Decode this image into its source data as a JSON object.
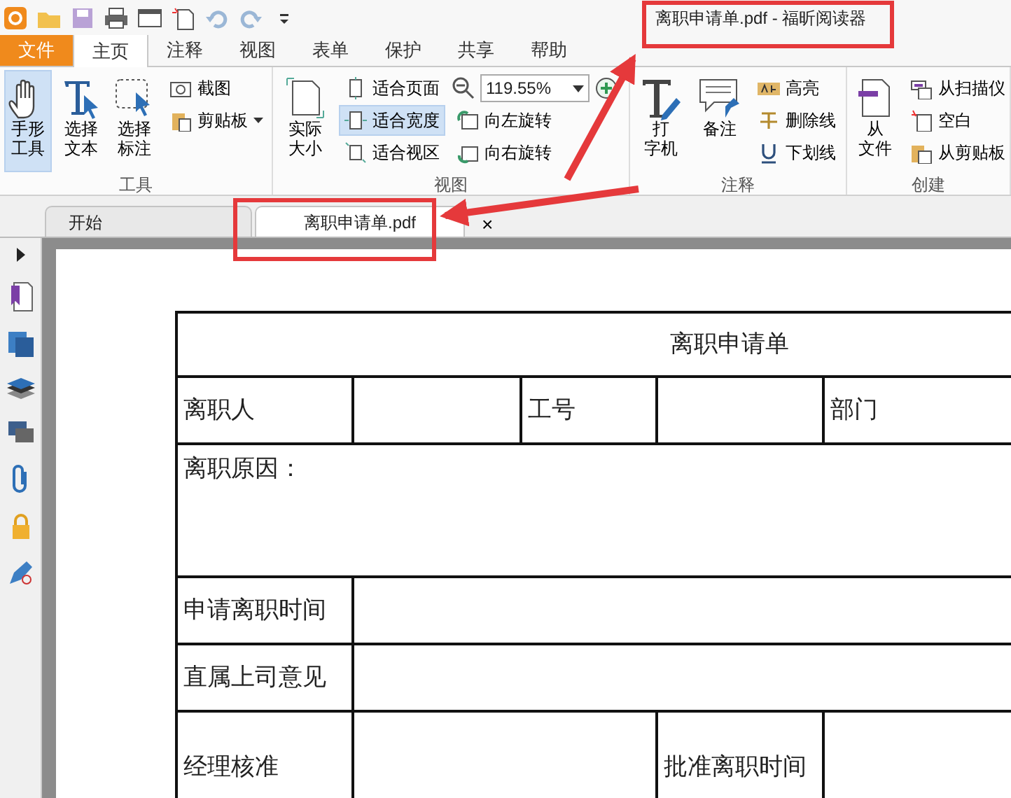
{
  "window": {
    "title": "离职申请单.pdf - 福昕阅读器"
  },
  "menu_tabs": [
    {
      "label": "文件",
      "kind": "file",
      "selected": false
    },
    {
      "label": "主页",
      "kind": "tab",
      "selected": true
    },
    {
      "label": "注释",
      "kind": "tab",
      "selected": false
    },
    {
      "label": "视图",
      "kind": "tab",
      "selected": false
    },
    {
      "label": "表单",
      "kind": "tab",
      "selected": false
    },
    {
      "label": "保护",
      "kind": "tab",
      "selected": false
    },
    {
      "label": "共享",
      "kind": "tab",
      "selected": false
    },
    {
      "label": "帮助",
      "kind": "tab",
      "selected": false
    }
  ],
  "ribbon": {
    "groups": [
      {
        "label": "工具",
        "columns": [
          {
            "kind": "large",
            "lines": [
              "手形",
              "工具"
            ],
            "selected": true
          },
          {
            "kind": "large",
            "lines": [
              "选择",
              "文本"
            ],
            "selected": false
          },
          {
            "kind": "large",
            "lines": [
              "选择",
              "标注"
            ],
            "selected": false
          },
          {
            "kind": "stack",
            "items": [
              {
                "label": "截图",
                "selected": false
              },
              {
                "label": "剪贴板",
                "selected": false,
                "dropdown": true
              }
            ]
          }
        ]
      },
      {
        "label": "视图",
        "columns": [
          {
            "kind": "large",
            "lines": [
              "实际",
              "大小"
            ],
            "selected": false
          },
          {
            "kind": "stack",
            "items": [
              {
                "label": "适合页面",
                "selected": false
              },
              {
                "label": "适合宽度",
                "selected": true
              },
              {
                "label": "适合视区",
                "selected": false
              }
            ]
          },
          {
            "kind": "stack",
            "zoom": {
              "value": "119.55%"
            },
            "items": [
              {
                "label": "向左旋转",
                "selected": false
              },
              {
                "label": "向右旋转",
                "selected": false
              }
            ]
          }
        ]
      },
      {
        "label": "注释",
        "columns": [
          {
            "kind": "large",
            "lines": [
              "打",
              "字机"
            ],
            "selected": false
          },
          {
            "kind": "large",
            "lines": [
              "备注"
            ],
            "selected": false
          },
          {
            "kind": "stack",
            "items": [
              {
                "label": "高亮",
                "selected": false
              },
              {
                "label": "删除线",
                "selected": false
              },
              {
                "label": "下划线",
                "selected": false
              }
            ]
          }
        ]
      },
      {
        "label": "创建",
        "columns": [
          {
            "kind": "large",
            "lines": [
              "从",
              "文件"
            ],
            "selected": false
          },
          {
            "kind": "stack",
            "items": [
              {
                "label": "从扫描仪",
                "selected": false
              },
              {
                "label": "空白",
                "selected": false
              },
              {
                "label": "从剪贴板",
                "selected": false
              }
            ]
          }
        ]
      }
    ]
  },
  "doc_tabs": [
    {
      "label": "开始",
      "selected": false
    },
    {
      "label": "离职申请单.pdf",
      "selected": true,
      "close": "×"
    }
  ],
  "form": {
    "rows": [
      {
        "kind": "title",
        "cells": [
          {
            "text": "离职申请单",
            "colspan": 6
          }
        ]
      },
      {
        "kind": "normal",
        "cells": [
          {
            "text": "离职人"
          },
          {},
          {
            "text": "工号"
          },
          {},
          {
            "text": "部门",
            "colspan": 2
          }
        ]
      },
      {
        "kind": "tall",
        "cells": [
          {
            "text": "离职原因：",
            "colspan": 6
          }
        ]
      },
      {
        "kind": "normal",
        "cells": [
          {
            "text": "申请离职时间"
          },
          {
            "colspan": 5
          }
        ]
      },
      {
        "kind": "normal",
        "cells": [
          {
            "text": "直属上司意见"
          },
          {
            "colspan": 5
          }
        ]
      },
      {
        "kind": "last",
        "cells": [
          {
            "text": "经理核准"
          },
          {
            "colspan": 2
          },
          {
            "text": "批准离职时间"
          },
          {
            "colspan": 2
          }
        ]
      }
    ]
  }
}
